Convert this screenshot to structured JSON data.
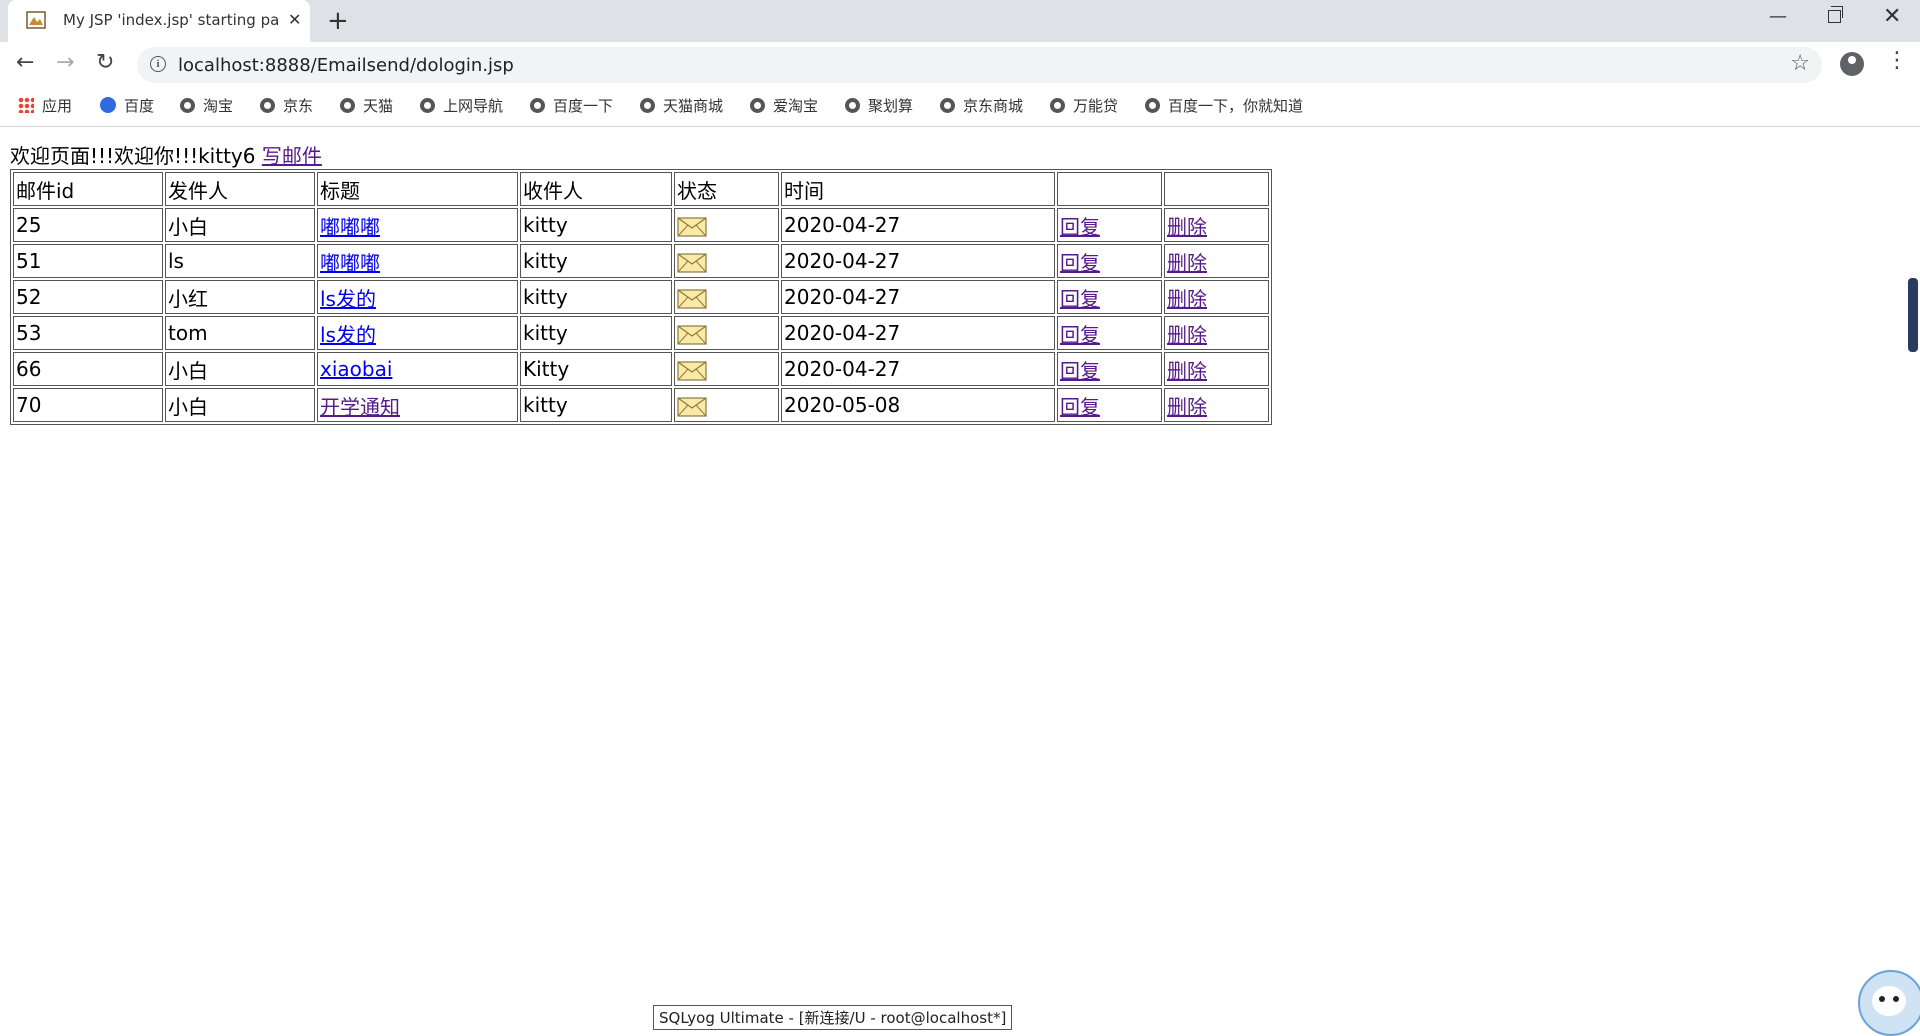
{
  "browser": {
    "tab_title": "My JSP 'index.jsp' starting page",
    "url": "localhost:8888/Emailsend/dologin.jsp",
    "bookmarks": [
      "应用",
      "百度",
      "淘宝",
      "京东",
      "天猫",
      "上网导航",
      "百度一下",
      "天猫商城",
      "爱淘宝",
      "聚划算",
      "京东商城",
      "万能贷",
      "百度一下，你就知道"
    ]
  },
  "page": {
    "welcome_text": "欢迎页面!!!欢迎你!!!kitty6",
    "write_link": "写邮件",
    "headers": [
      "邮件id",
      "发件人",
      "标题",
      "收件人",
      "状态",
      "时间",
      "",
      ""
    ],
    "rows": [
      {
        "id": "25",
        "sender": "小白",
        "title": "嘟嘟嘟",
        "recipient": "kitty",
        "status": "envelope-icon",
        "time": "2020-04-27",
        "reply": "回复",
        "delete": "删除"
      },
      {
        "id": "51",
        "sender": "ls",
        "title": "嘟嘟嘟",
        "recipient": "kitty",
        "status": "envelope-icon",
        "time": "2020-04-27",
        "reply": "回复",
        "delete": "删除"
      },
      {
        "id": "52",
        "sender": "小红",
        "title": "ls发的",
        "recipient": "kitty",
        "status": "envelope-icon",
        "time": "2020-04-27",
        "reply": "回复",
        "delete": "删除"
      },
      {
        "id": "53",
        "sender": "tom",
        "title": "ls发的",
        "recipient": "kitty",
        "status": "envelope-icon",
        "time": "2020-04-27",
        "reply": "回复",
        "delete": "删除"
      },
      {
        "id": "66",
        "sender": "小白",
        "title": "xiaobai",
        "recipient": "Kitty",
        "status": "envelope-icon",
        "time": "2020-04-27",
        "reply": "回复",
        "delete": "删除"
      },
      {
        "id": "70",
        "sender": "小白",
        "title": "开学通知",
        "recipient": "kitty",
        "status": "envelope-icon",
        "time": "2020-05-08",
        "reply": "回复",
        "delete": "删除"
      }
    ]
  },
  "overlay": {
    "taskbar_tooltip": "SQLyog Ultimate - [新连接/U - root@localhost*]"
  }
}
